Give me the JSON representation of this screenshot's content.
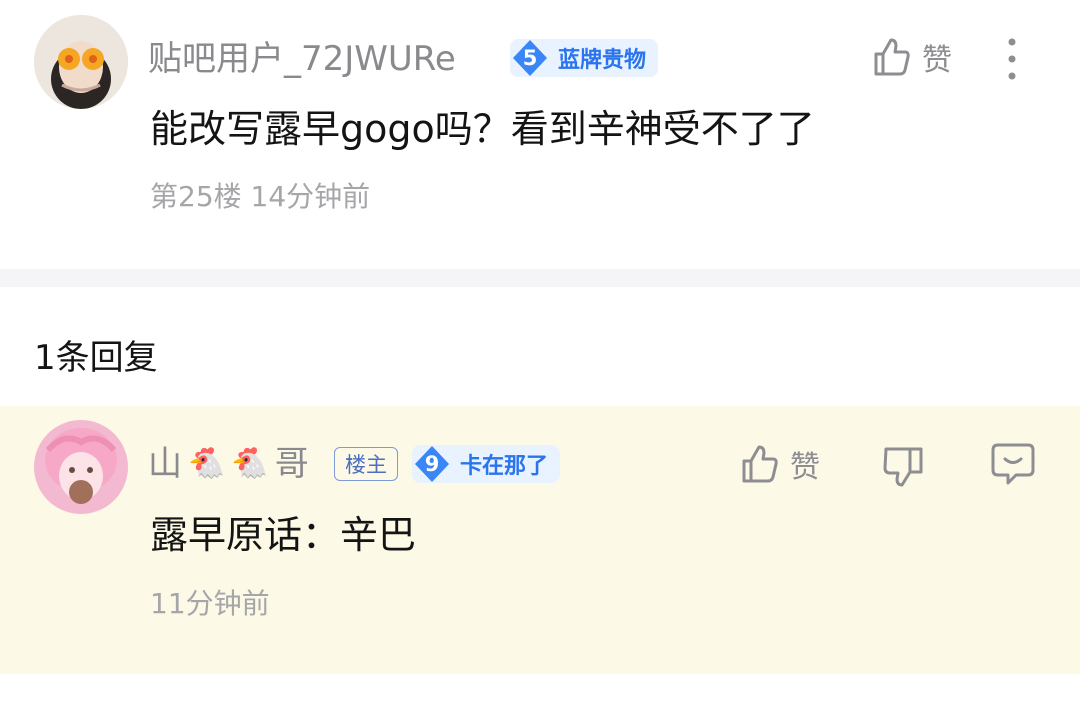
{
  "post": {
    "username": "贴吧用户_72JWURe",
    "level": "5",
    "badge_label": "蓝牌贵物",
    "like_label": "赞",
    "content": "能改写露早gogo吗？看到辛神受不了了",
    "floor_time": "第25楼 14分钟前"
  },
  "replies_header": "1条回复",
  "reply": {
    "username_prefix": "山",
    "username_suffix": "哥",
    "emoji": "🐔",
    "owner_tag": "楼主",
    "level": "9",
    "badge_label": "卡在那了",
    "like_label": "赞",
    "content": "露早原话：辛巴",
    "time": "11分钟前"
  },
  "colors": {
    "badge_blue": "#2a74ee",
    "badge_bg": "#e9f2ff",
    "reply_bg": "#fcf9e7",
    "divider": "#f5f5f7"
  }
}
